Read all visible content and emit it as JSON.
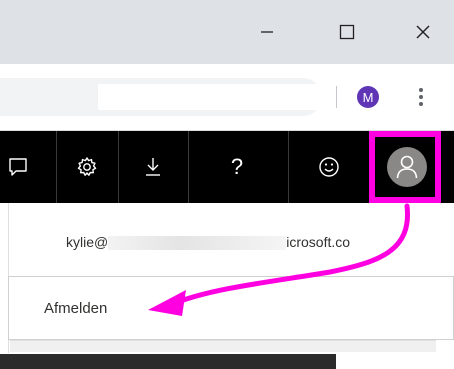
{
  "window": {
    "controls": [
      {
        "name": "minimize",
        "icon": "minimize-icon"
      },
      {
        "name": "maximize",
        "icon": "maximize-icon"
      },
      {
        "name": "close",
        "icon": "close-icon"
      }
    ]
  },
  "browser": {
    "profile_initial": "M",
    "profile_color": "#5f35b5",
    "menu_icon": "kebab-menu-icon"
  },
  "suite_bar": {
    "background": "#000000",
    "icons": [
      "feedback-icon",
      "gear-icon",
      "download-icon",
      "help-icon",
      "smiley-icon",
      "avatar-icon"
    ],
    "help_label": "?"
  },
  "account_panel": {
    "email_prefix": "kylie@",
    "email_suffix": "icrosoft.co",
    "sign_out_label": "Afmelden"
  },
  "annotation": {
    "highlight_color": "#ff00e0"
  }
}
